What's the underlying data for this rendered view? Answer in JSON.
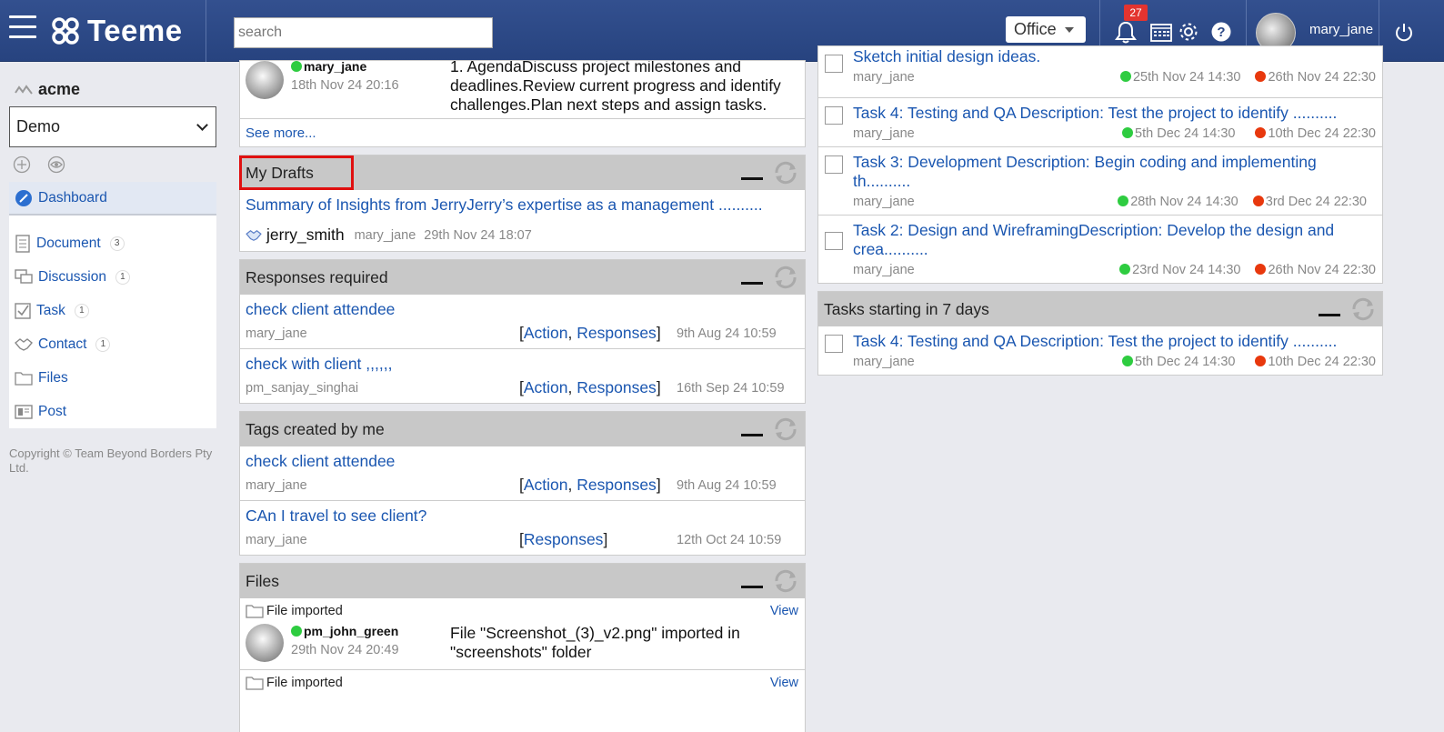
{
  "header": {
    "app_name": "Teeme",
    "search_placeholder": "search",
    "office_label": "Office",
    "notification_count": "27",
    "username": "mary_jane"
  },
  "sidebar": {
    "org_name": "acme",
    "workspace_selected": "Demo",
    "items": [
      {
        "label": "Dashboard",
        "count": "",
        "icon": "dashboard-icon"
      },
      {
        "label": "Document",
        "count": "3",
        "icon": "document-icon"
      },
      {
        "label": "Discussion",
        "count": "1",
        "icon": "discussion-icon"
      },
      {
        "label": "Task",
        "count": "1",
        "icon": "task-icon"
      },
      {
        "label": "Contact",
        "count": "1",
        "icon": "contact-icon"
      },
      {
        "label": "Files",
        "count": "",
        "icon": "folder-icon"
      },
      {
        "label": "Post",
        "count": "",
        "icon": "post-icon"
      }
    ],
    "copyright": "Copyright © Team Beyond Borders Pty Ltd."
  },
  "top_post": {
    "user": "mary_jane",
    "date": "18th Nov 24 20:16",
    "text": "1. AgendaDiscuss project milestones and deadlines.Review current progress and identify challenges.Plan next steps and assign tasks.",
    "see_more": "See more..."
  },
  "drafts": {
    "title": "My Drafts",
    "item_title": "Summary of Insights from JerryJerry’s expertise as a management ..........",
    "contact": "jerry_smith",
    "user": "mary_jane",
    "date": "29th Nov 24 18:07"
  },
  "responses": {
    "title": "Responses required",
    "items": [
      {
        "title": "check client attendee",
        "user": "mary_jane",
        "tag1": "Action",
        "tag2": "Responses",
        "date": "9th Aug 24 10:59"
      },
      {
        "title": "check with client ,,,,,,",
        "user": "pm_sanjay_singhai",
        "tag1": "Action",
        "tag2": "Responses",
        "date": "16th Sep 24 10:59"
      }
    ]
  },
  "tags": {
    "title": "Tags created by me",
    "items": [
      {
        "title": "check client attendee",
        "user": "mary_jane",
        "tag1": "Action",
        "tag2": "Responses",
        "date": "9th Aug 24 10:59"
      },
      {
        "title": "CAn I travel to see client?",
        "user": "mary_jane",
        "tag1": "Responses",
        "date": "12th Oct 24 10:59"
      }
    ]
  },
  "files": {
    "title": "Files",
    "items": [
      {
        "type": "File imported",
        "view": "View",
        "user": "pm_john_green",
        "date": "29th Nov 24 20:49",
        "text": "File \"Screenshot_(3)_v2.png\" imported in \"screenshots\" folder"
      },
      {
        "type": "File imported",
        "view": "View"
      }
    ]
  },
  "tasks": {
    "items": [
      {
        "title": "Sketch initial design ideas.",
        "user": "mary_jane",
        "start": "25th Nov 24 14:30",
        "end": "26th Nov 24 22:30"
      },
      {
        "title": "Task 4: Testing and QA Description: Test the project to identify ..........",
        "user": "mary_jane",
        "start": "5th Dec 24 14:30",
        "end": "10th Dec 24 22:30"
      },
      {
        "title": "Task 3: Development Description: Begin coding and implementing th..........",
        "user": "mary_jane",
        "start": "28th Nov 24 14:30",
        "end": "3rd Dec 24 22:30"
      },
      {
        "title": "Task 2: Design and WireframingDescription: Develop the design and crea..........",
        "user": "mary_jane",
        "start": "23rd Nov 24 14:30",
        "end": "26th Nov 24 22:30"
      }
    ]
  },
  "tasks7": {
    "title": "Tasks starting in 7 days",
    "items": [
      {
        "title": "Task 4: Testing and QA Description: Test the project to identify ..........",
        "user": "mary_jane",
        "start": "5th Dec 24 14:30",
        "end": "10th Dec 24 22:30"
      }
    ]
  },
  "colors": {
    "header": "#2c4886",
    "link": "#1a56b0",
    "panel_head": "#c8c8c8",
    "highlight": "#e01010"
  }
}
